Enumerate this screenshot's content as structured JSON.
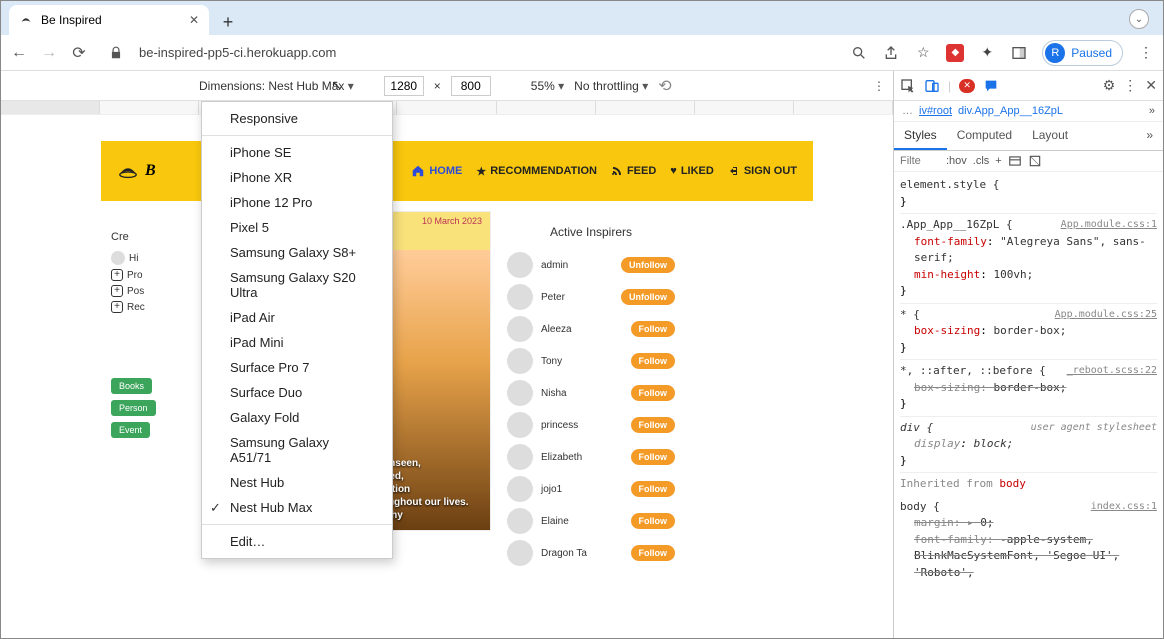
{
  "window": {
    "title": "Be Inspired"
  },
  "browser": {
    "url": "be-inspired-pp5-ci.herokuapp.com",
    "profile_letter": "R",
    "profile_label": "Paused"
  },
  "devtoolbar": {
    "dimensions_label": "Dimensions: Nest Hub Max",
    "width": "1280",
    "height": "800",
    "dim_sep": "×",
    "zoom": "55%",
    "throttle": "No throttling"
  },
  "dropdown": {
    "items": [
      "Responsive",
      "iPhone SE",
      "iPhone XR",
      "iPhone 12 Pro",
      "Pixel 5",
      "Samsung Galaxy S8+",
      "Samsung Galaxy S20 Ultra",
      "iPad Air",
      "iPad Mini",
      "Surface Pro 7",
      "Surface Duo",
      "Galaxy Fold",
      "Samsung Galaxy A51/71",
      "Nest Hub",
      "Nest Hub Max",
      "Edit…"
    ],
    "checked": "Nest Hub Max"
  },
  "site": {
    "brand_initial": "B",
    "nav": {
      "home": "HOME",
      "recommendation": "RECOMMENDATION",
      "feed": "FEED",
      "liked": "LIKED",
      "signout": "SIGN OUT"
    },
    "left": {
      "create": "Cre",
      "hi": "Hi",
      "pro": "Pro",
      "pos": "Pos",
      "rec": "Rec",
      "pills": {
        "books": "Books",
        "person": "Person",
        "event": "Event"
      }
    },
    "post": {
      "date": "10 March 2023",
      "lines": [
        "er's tears and fears are unseen,",
        "his love is unexpressed,",
        "but his care and protection",
        "remains as a pillar of strength throughout our lives.",
        "- Ama H. Vanniarachchy"
      ]
    },
    "inspirers": {
      "title": "Active Inspirers",
      "list": [
        {
          "name": "admin",
          "btn": "Unfollow"
        },
        {
          "name": "Peter",
          "btn": "Unfollow"
        },
        {
          "name": "Aleeza",
          "btn": "Follow"
        },
        {
          "name": "Tony",
          "btn": "Follow"
        },
        {
          "name": "Nisha",
          "btn": "Follow"
        },
        {
          "name": "princess",
          "btn": "Follow"
        },
        {
          "name": "Elizabeth",
          "btn": "Follow"
        },
        {
          "name": "jojo1",
          "btn": "Follow"
        },
        {
          "name": "Elaine",
          "btn": "Follow"
        },
        {
          "name": "Dragon Ta",
          "btn": "Follow"
        }
      ]
    }
  },
  "devtools": {
    "crumb_pre": "…",
    "crumb_el": "iv#root",
    "crumb_cls": "div.App_App__16ZpL",
    "tabs": {
      "styles": "Styles",
      "computed": "Computed",
      "layout": "Layout"
    },
    "filter_placeholder": "Filte",
    "hov": ":hov",
    "cls": ".cls",
    "rules": {
      "r0": {
        "sel": "element.style {",
        "close": "}"
      },
      "r1": {
        "sel": ".App_App__16ZpL {",
        "src": "App.module.css:1",
        "p1n": "font-family",
        "p1v": "\"Alegreya Sans\", sans-serif;",
        "p2n": "min-height",
        "p2v": "100vh;",
        "close": "}"
      },
      "r2": {
        "sel": "* {",
        "src": "App.module.css:25",
        "p1n": "box-sizing",
        "p1v": "border-box;",
        "close": "}"
      },
      "r3": {
        "sel": "*, ::after, ::before {",
        "src": "_reboot.scss:22",
        "p1n": "box-sizing",
        "p1v": "border-box;",
        "close": "}"
      },
      "r4": {
        "sel": "div {",
        "src": "user agent stylesheet",
        "p1n": "display",
        "p1v": "block;",
        "close": "}"
      },
      "inh": "Inherited from ",
      "inh_el": "body",
      "r5": {
        "sel": "body {",
        "src": "index.css:1",
        "p1n": "margin",
        "p1arrow": "▸",
        "p1v": "0;",
        "p2n": "font-family",
        "p2v": "-apple-system, BlinkMacSystemFont, 'Segoe UI', 'Roboto',"
      }
    }
  }
}
